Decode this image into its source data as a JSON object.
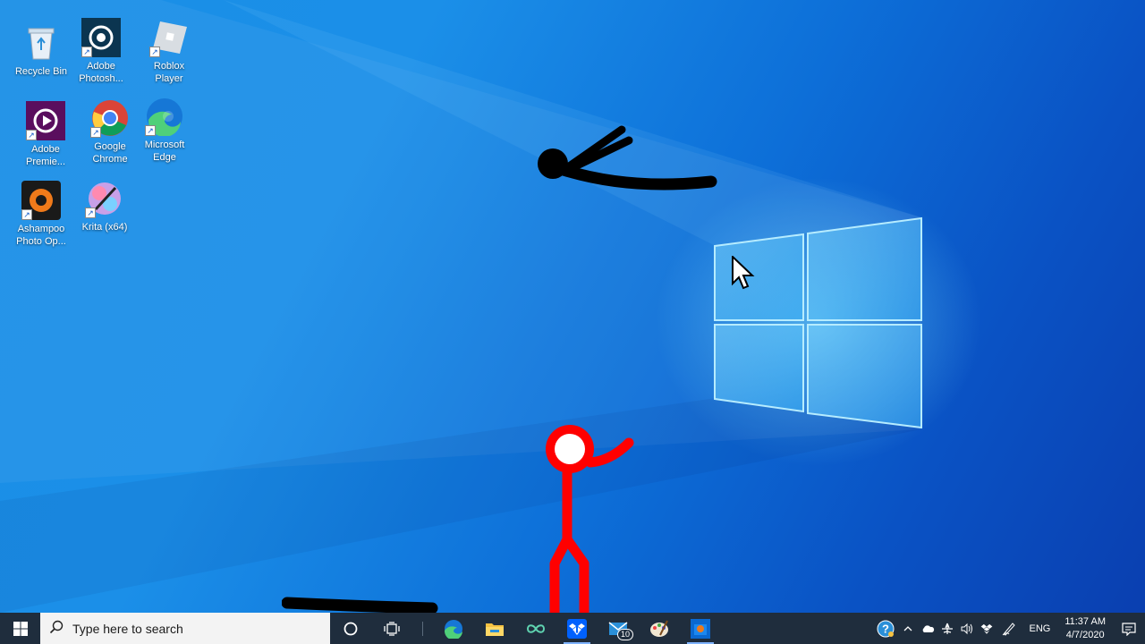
{
  "desktop_icons": [
    {
      "label": "Recycle Bin",
      "icon": "recycle-bin-icon"
    },
    {
      "label": "Adobe Photosh...",
      "icon": "photoshop-icon"
    },
    {
      "label": "Roblox Player",
      "icon": "roblox-icon"
    },
    {
      "label": "Adobe Premie...",
      "icon": "premiere-icon"
    },
    {
      "label": "Google Chrome",
      "icon": "chrome-icon"
    },
    {
      "label": "Microsoft Edge",
      "icon": "edge-icon"
    },
    {
      "label": "Ashampoo Photo Op...",
      "icon": "ashampoo-icon"
    },
    {
      "label": "Krita (x64)",
      "icon": "krita-icon"
    }
  ],
  "taskbar": {
    "search_placeholder": "Type here to search",
    "apps": [
      {
        "name": "cortana",
        "icon": "cortana-circle-icon"
      },
      {
        "name": "task-view",
        "icon": "task-view-icon"
      },
      {
        "name": "edge",
        "icon": "edge-icon"
      },
      {
        "name": "file-explorer",
        "icon": "folder-icon"
      },
      {
        "name": "infinity",
        "icon": "infinity-icon"
      },
      {
        "name": "dropbox",
        "icon": "dropbox-icon"
      },
      {
        "name": "mail",
        "icon": "mail-icon",
        "badge": "10"
      },
      {
        "name": "paint",
        "icon": "palette-icon"
      },
      {
        "name": "store",
        "icon": "store-icon"
      }
    ],
    "tray": {
      "language": "ENG",
      "time": "11:37 AM",
      "date": "4/7/2020"
    }
  },
  "colors": {
    "taskbar": "#1f2d3d",
    "stick_red": "#ff0000",
    "stick_black": "#000000"
  }
}
